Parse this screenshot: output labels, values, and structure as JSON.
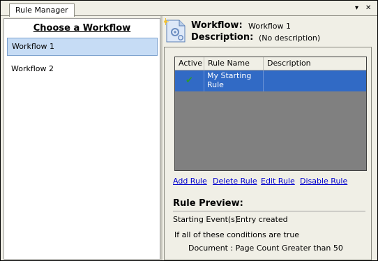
{
  "tab": {
    "title": "Rule Manager",
    "pin_glyph": "▾",
    "close_glyph": "✕"
  },
  "workflow_list": {
    "heading": "Choose a Workflow",
    "items": [
      {
        "label": "Workflow 1",
        "selected": true
      },
      {
        "label": "Workflow 2",
        "selected": false
      }
    ]
  },
  "header": {
    "icon": "workflow-document-gear-icon",
    "workflow_label": "Workflow:",
    "workflow_value": "Workflow 1",
    "description_label": "Description:",
    "description_value": "(No description)"
  },
  "rules_grid": {
    "columns": [
      "Active",
      "Rule Name",
      "Description"
    ],
    "rows": [
      {
        "active": "✔",
        "rule_name_line1": "My Starting",
        "rule_name_line2": "Rule",
        "description": "",
        "selected": true
      }
    ]
  },
  "actions": {
    "add": "Add Rule",
    "delete": "Delete Rule",
    "edit": "Edit Rule",
    "disable": "Disable Rule"
  },
  "preview": {
    "title": "Rule Preview:",
    "events_label": "Starting Event(s):",
    "events_value": "Entry created",
    "conditions_intro": "If all of these conditions are true",
    "condition_1": "Document : Page Count Greater than 50"
  },
  "colors": {
    "selection_blue": "#316ac5",
    "list_selection": "#c6dcf5",
    "link": "#0000cc",
    "check_green": "#2e9a2e"
  }
}
